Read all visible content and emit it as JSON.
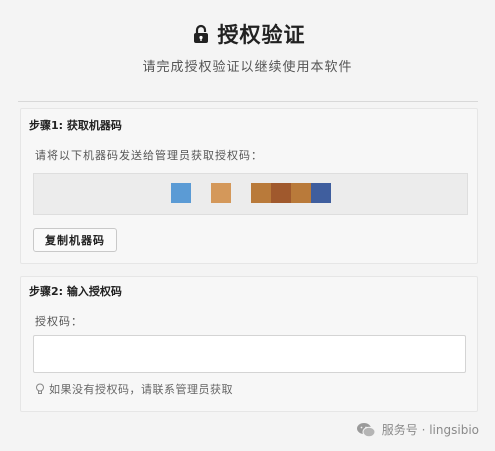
{
  "header": {
    "title": "授权验证",
    "subtitle": "请完成授权验证以继续使用本软件",
    "icon": "lock-icon"
  },
  "step1": {
    "title": "步骤1: 获取机器码",
    "hint": "请将以下机器码发送给管理员获取授权码：",
    "copy_label": "复制机器码",
    "machine_code_colors": [
      "#5b9bd5",
      "#d4985a",
      "#b97a3a",
      "#a0592d",
      "#b97a3a",
      "#3f5e9e"
    ]
  },
  "step2": {
    "title": "步骤2: 输入授权码",
    "label": "授权码：",
    "input_value": "",
    "tip": "如果没有授权码，请联系管理员获取",
    "tip_icon": "lightbulb-icon"
  },
  "watermark": {
    "text": "服务号 · lingsibio",
    "icon": "wechat-icon"
  },
  "colors": {
    "background": "#f4f4f4",
    "section": "#f7f7f7",
    "border": "#e6e6e6",
    "text": "#333333"
  }
}
